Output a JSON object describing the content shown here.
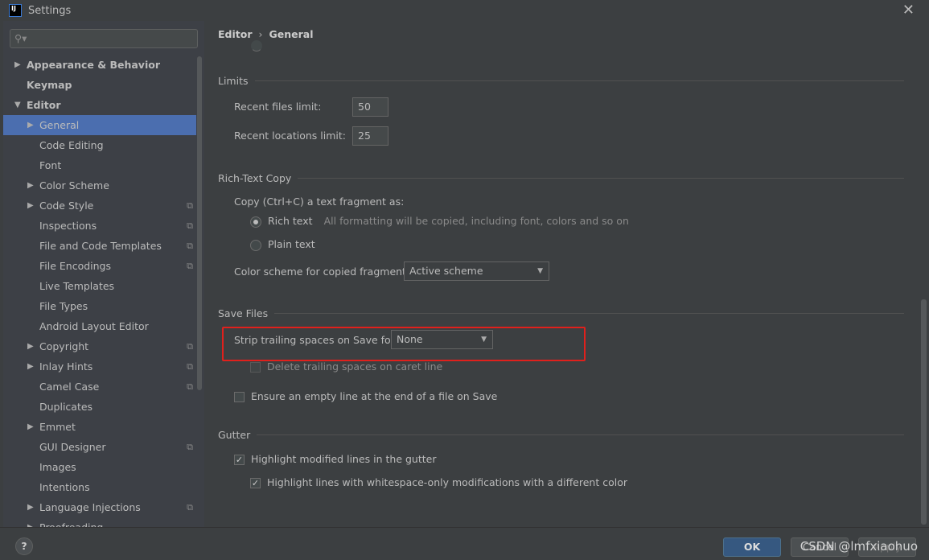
{
  "window": {
    "title": "Settings"
  },
  "sidebar": {
    "search_placeholder": "",
    "items": [
      {
        "label": "Appearance & Behavior"
      },
      {
        "label": "Keymap"
      },
      {
        "label": "Editor"
      },
      {
        "label": "General"
      },
      {
        "label": "Code Editing"
      },
      {
        "label": "Font"
      },
      {
        "label": "Color Scheme"
      },
      {
        "label": "Code Style"
      },
      {
        "label": "Inspections"
      },
      {
        "label": "File and Code Templates"
      },
      {
        "label": "File Encodings"
      },
      {
        "label": "Live Templates"
      },
      {
        "label": "File Types"
      },
      {
        "label": "Android Layout Editor"
      },
      {
        "label": "Copyright"
      },
      {
        "label": "Inlay Hints"
      },
      {
        "label": "Camel Case"
      },
      {
        "label": "Duplicates"
      },
      {
        "label": "Emmet"
      },
      {
        "label": "GUI Designer"
      },
      {
        "label": "Images"
      },
      {
        "label": "Intentions"
      },
      {
        "label": "Language Injections"
      },
      {
        "label": "Proofreading"
      }
    ]
  },
  "breadcrumb": {
    "parent": "Editor",
    "sep": "›",
    "current": "General"
  },
  "limits": {
    "title": "Limits",
    "recent_files_label": "Recent files limit:",
    "recent_files_value": "50",
    "recent_locations_label": "Recent locations limit:",
    "recent_locations_value": "25"
  },
  "rich_text": {
    "title": "Rich-Text Copy",
    "copy_label": "Copy (Ctrl+C) a text fragment as:",
    "rich_label": "Rich text",
    "rich_hint": "All formatting will be copied, including font, colors and so on",
    "plain_label": "Plain text",
    "scheme_label": "Color scheme for copied fragment:",
    "scheme_value": "Active scheme"
  },
  "save_files": {
    "title": "Save Files",
    "strip_label": "Strip trailing spaces on Save for:",
    "strip_value": "None",
    "delete_caret_label": "Delete trailing spaces on caret line",
    "ensure_empty_label": "Ensure an empty line at the end of a file on Save"
  },
  "gutter": {
    "title": "Gutter",
    "highlight_modified_label": "Highlight modified lines in the gutter",
    "highlight_whitespace_label": "Highlight lines with whitespace-only modifications with a different color"
  },
  "buttons": {
    "ok": "OK",
    "cancel": "Cancel",
    "apply": "Apply",
    "help": "?"
  },
  "watermark": "CSDN @lmfxiaohuo"
}
